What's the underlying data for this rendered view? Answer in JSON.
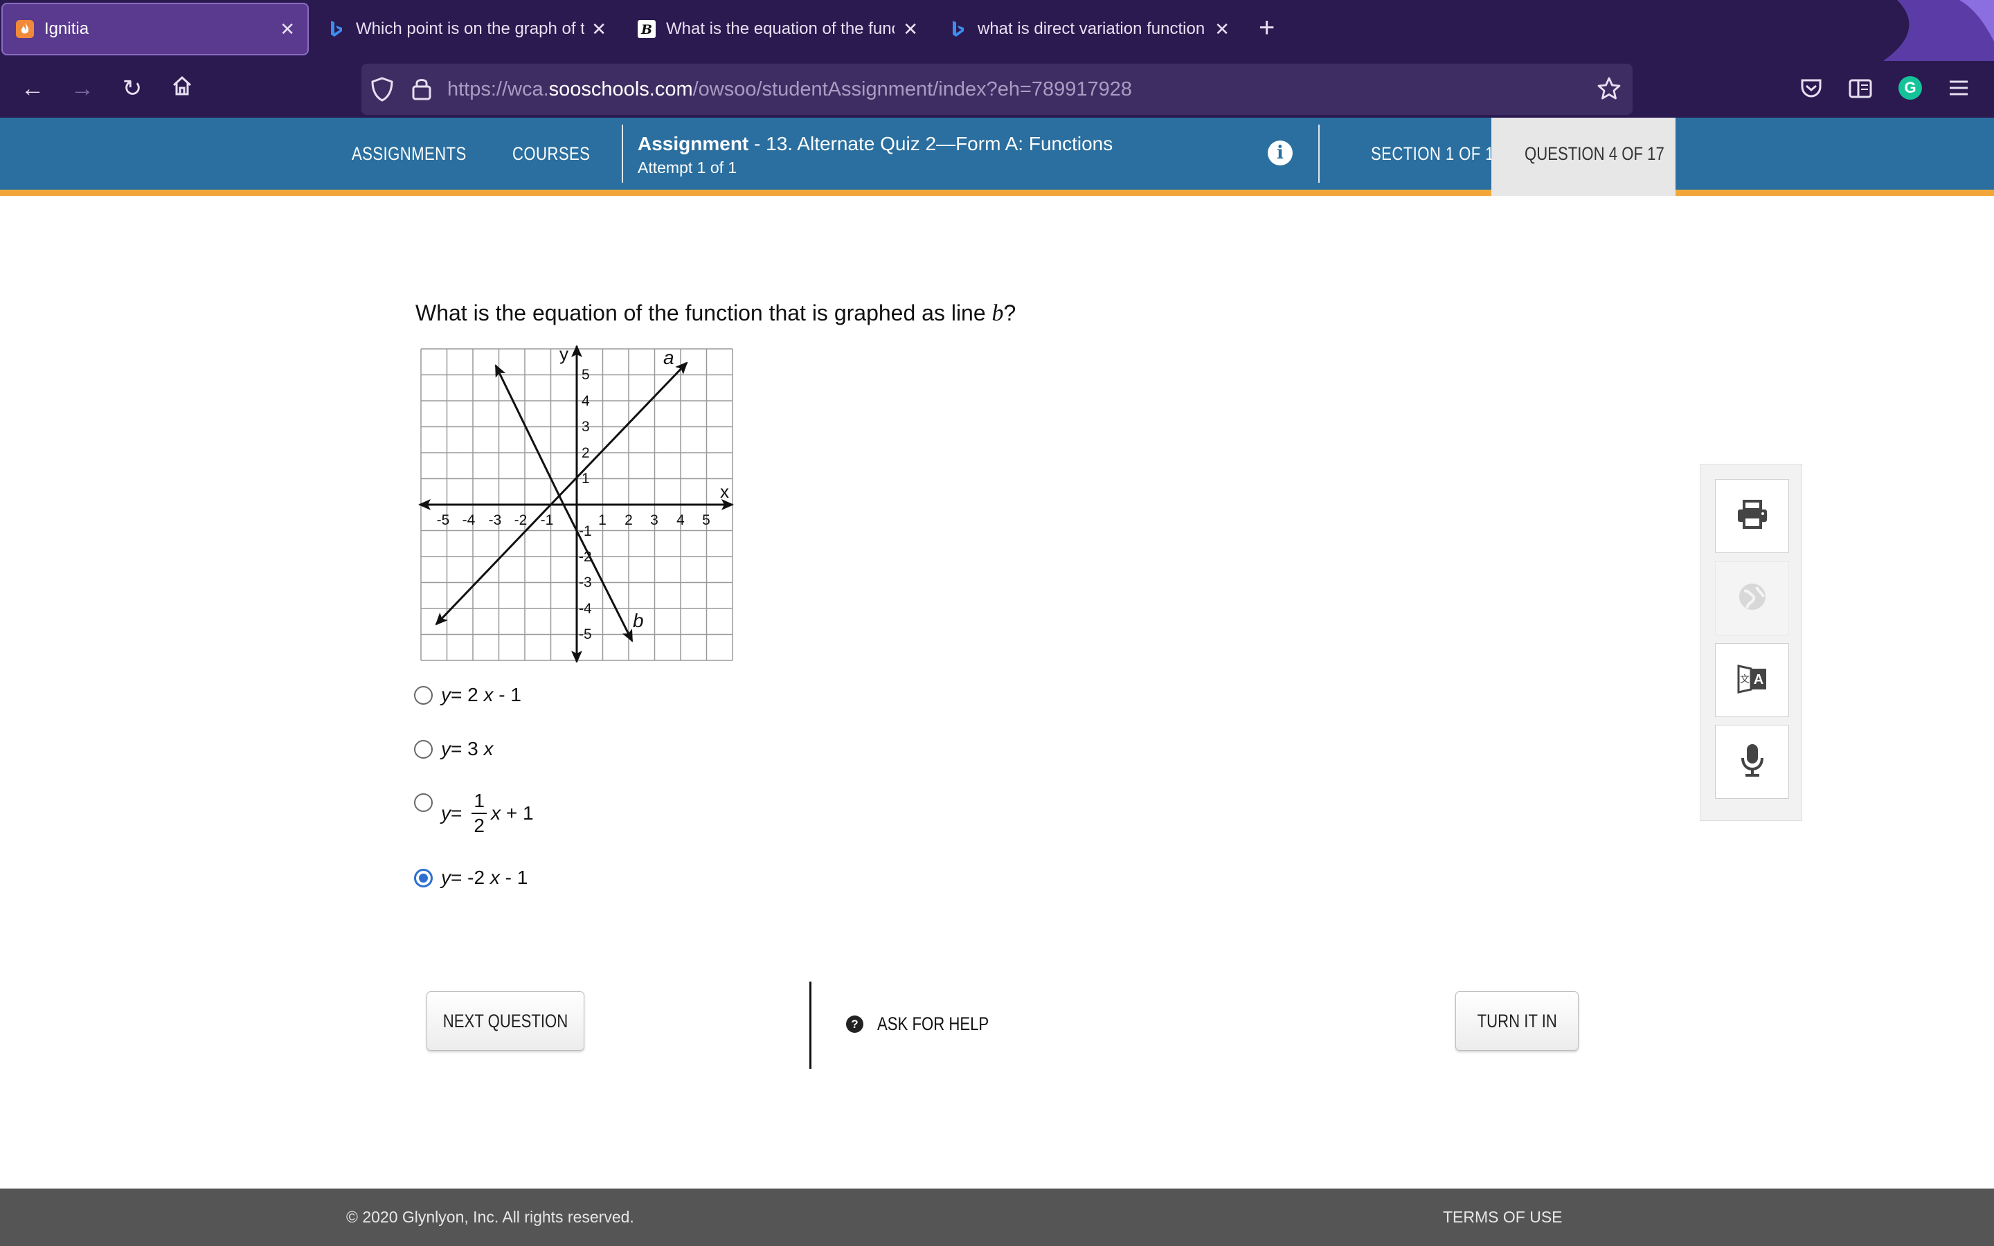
{
  "browser": {
    "tabs": [
      {
        "title": "Ignitia",
        "favicon": "ignitia-flame-icon",
        "active": true
      },
      {
        "title": "Which point is on the graph of th",
        "favicon": "bing-icon",
        "active": false
      },
      {
        "title": "What is the equation of the func",
        "favicon": "brainly-icon",
        "active": false
      },
      {
        "title": "what is direct variation function",
        "favicon": "bing-icon",
        "active": false
      }
    ],
    "url_prefix": "https://wca.",
    "url_domain": "sooschools.com",
    "url_path": "/owsoo/studentAssignment/index?eh=789917928"
  },
  "header": {
    "nav_assignments": "ASSIGNMENTS",
    "nav_courses": "COURSES",
    "assignment_label": "Assignment",
    "assignment_name": " - 13. Alternate Quiz 2—Form A: Functions",
    "attempt": "Attempt 1 of 1",
    "section": "SECTION 1 OF 1",
    "question_counter": "QUESTION 4 OF 17"
  },
  "question": {
    "text_before": "What is the equation of the function that is graphed as line ",
    "text_var": "b",
    "text_after": "?",
    "graph": {
      "axis_x_label": "x",
      "axis_y_label": "y",
      "x_ticks": [
        "-5",
        "-4",
        "-3",
        "-2",
        "-1",
        "1",
        "2",
        "3",
        "4",
        "5"
      ],
      "y_ticks": [
        "5",
        "4",
        "3",
        "2",
        "1",
        "-1",
        "-2",
        "-3",
        "-4",
        "-5"
      ],
      "line_a_label": "a",
      "line_b_label": "b"
    },
    "choices": [
      {
        "lhs": "y",
        "rhs": "= 2 ",
        "var": "x",
        "tail": " - 1",
        "selected": false
      },
      {
        "lhs": "y",
        "rhs": "= 3 ",
        "var": "x",
        "tail": "",
        "selected": false
      },
      {
        "lhs": "y",
        "rhs": "= ",
        "num": "1",
        "den": "2",
        "var": "x",
        "tail": " + 1",
        "selected": false
      },
      {
        "lhs": "y",
        "rhs": "= -2 ",
        "var": "x",
        "tail": " - 1",
        "selected": true
      }
    ]
  },
  "tools": [
    "printer-icon",
    "globe-icon",
    "translate-icon",
    "microphone-icon"
  ],
  "actions": {
    "next": "NEXT QUESTION",
    "help": "ASK FOR HELP",
    "turn_in": "TURN IT IN"
  },
  "footer": {
    "copyright": "© 2020 Glynlyon, Inc. All rights reserved.",
    "terms": "TERMS OF USE"
  },
  "colors": {
    "chrome": "#2b1a4f",
    "appbar": "#2a6f9f",
    "accent_stripe": "#f2a73b",
    "radio_selected": "#2f6fd0",
    "footer": "#555555"
  }
}
